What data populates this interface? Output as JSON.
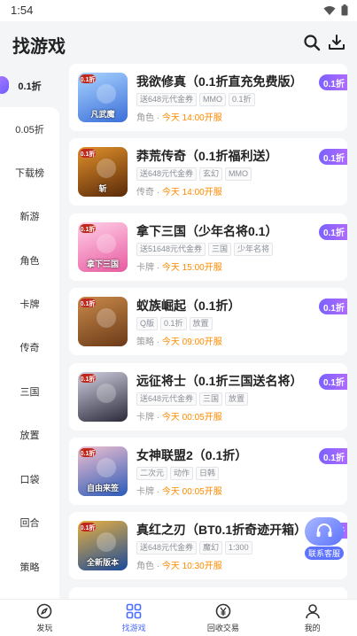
{
  "status": {
    "time": "1:54"
  },
  "header": {
    "title": "找游戏"
  },
  "sidebar": {
    "items": [
      {
        "label": "0.1折"
      },
      {
        "label": "0.05折"
      },
      {
        "label": "下载榜"
      },
      {
        "label": "新游"
      },
      {
        "label": "角色"
      },
      {
        "label": "卡牌"
      },
      {
        "label": "传奇"
      },
      {
        "label": "三国"
      },
      {
        "label": "放置"
      },
      {
        "label": "口袋"
      },
      {
        "label": "回合"
      },
      {
        "label": "策略"
      }
    ]
  },
  "games": [
    {
      "name": "我欲修真（0.1折直充免费版）",
      "tags": [
        "送648元代金券",
        "MMO",
        "0.1折"
      ],
      "category": "角色",
      "time": "今天 14:00开服",
      "discount": "0.1折",
      "icon_text": "凡武魔",
      "colors": [
        "#3a6fd8",
        "#a9d3ff"
      ]
    },
    {
      "name": "莽荒传奇（0.1折福利送）",
      "tags": [
        "送648元代金券",
        "玄幻",
        "MMO"
      ],
      "category": "传奇",
      "time": "今天 14:00开服",
      "discount": "0.1折",
      "icon_text": "斩",
      "colors": [
        "#5a2a0a",
        "#e0902a"
      ]
    },
    {
      "name": "拿下三国（少年名将0.1）",
      "tags": [
        "送51648元代金券",
        "三国",
        "少年名将"
      ],
      "category": "卡牌",
      "time": "今天 15:00开服",
      "discount": "0.1折",
      "icon_text": "拿下三国",
      "colors": [
        "#e85aa0",
        "#ffd0e8"
      ]
    },
    {
      "name": "蚁族崛起（0.1折）",
      "tags": [
        "Q版",
        "0.1折",
        "放置"
      ],
      "category": "策略",
      "time": "今天 09:00开服",
      "discount": "0.1折",
      "icon_text": "",
      "colors": [
        "#6b3a18",
        "#c98a4a"
      ]
    },
    {
      "name": "远征将士（0.1折三国送名将）",
      "tags": [
        "送648元代金券",
        "三国",
        "放置"
      ],
      "category": "卡牌",
      "time": "今天 00:05开服",
      "discount": "0.1折",
      "icon_text": "",
      "colors": [
        "#2a2a3a",
        "#d0d0e0"
      ]
    },
    {
      "name": "女神联盟2（0.1折）",
      "tags": [
        "二次元",
        "动作",
        "日韩"
      ],
      "category": "卡牌",
      "time": "今天 00:05开服",
      "discount": "0.1折",
      "icon_text": "自由来签",
      "colors": [
        "#2a5ab8",
        "#f0c0d0"
      ]
    },
    {
      "name": "真红之刃（BT0.1折奇迹开箱）",
      "tags": [
        "送648元代金券",
        "魔幻",
        "1:300"
      ],
      "category": "角色",
      "time": "今天 10:30开服",
      "discount": "0.1折",
      "icon_text": "全新版本",
      "colors": [
        "#1a4a9a",
        "#e8b040"
      ]
    }
  ],
  "float_service": {
    "label": "联系客服"
  },
  "tabbar": {
    "items": [
      {
        "label": "发玩"
      },
      {
        "label": "找游戏"
      },
      {
        "label": "回收交易"
      },
      {
        "label": "我的"
      }
    ]
  },
  "theme": {
    "accent": "#4a6cff",
    "time_color": "#ff8a00",
    "badge_gradient": [
      "#7b61ff",
      "#b26bff"
    ]
  }
}
